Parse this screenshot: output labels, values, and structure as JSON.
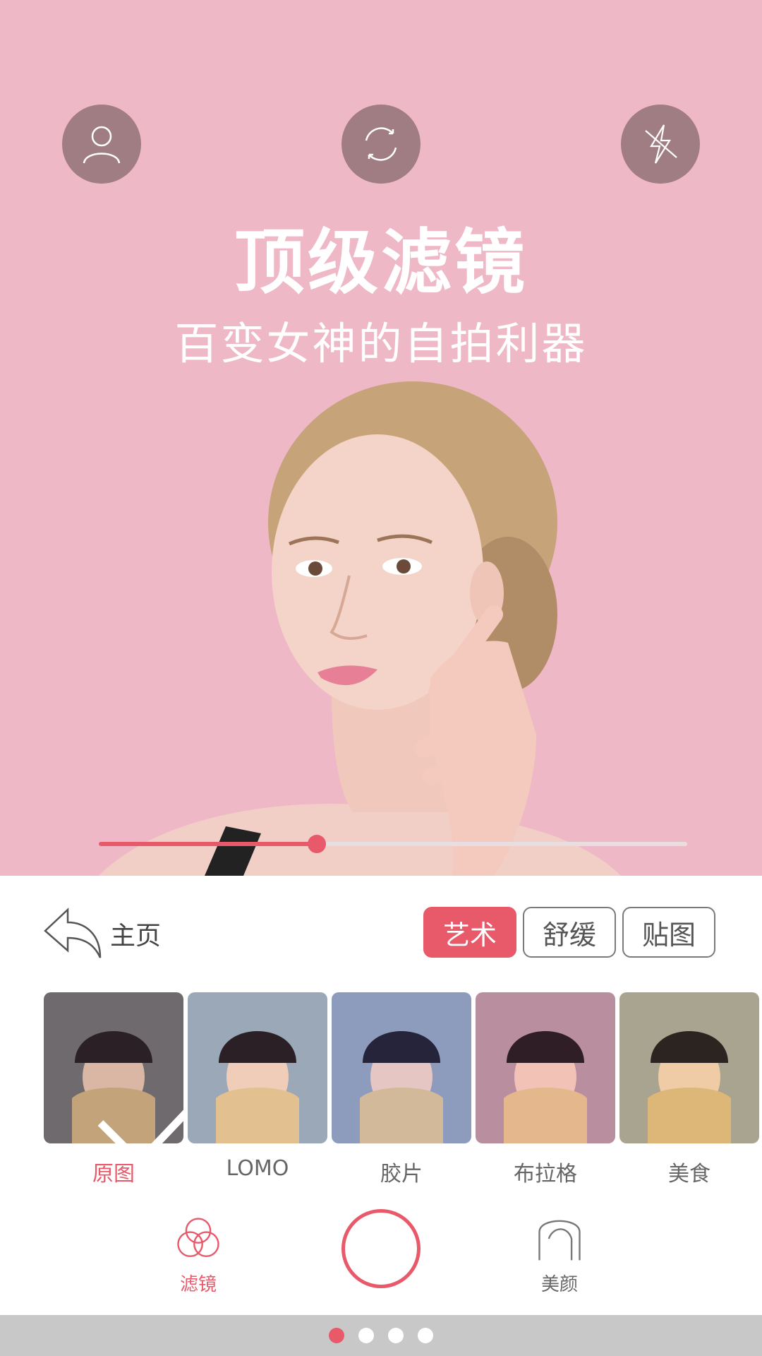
{
  "hero": {
    "title": "顶级滤镜",
    "subtitle": "百变女神的自拍利器"
  },
  "top_controls": [
    {
      "icon": "user-icon"
    },
    {
      "icon": "switch-camera-icon"
    },
    {
      "icon": "flash-off-icon"
    }
  ],
  "intensity_slider": {
    "value": 0.37
  },
  "toolbar": {
    "home_label": "主页",
    "tabs": [
      {
        "label": "艺术",
        "active": true
      },
      {
        "label": "舒缓",
        "active": false
      },
      {
        "label": "贴图",
        "active": false
      }
    ]
  },
  "filters": [
    {
      "label": "原图",
      "selected": true
    },
    {
      "label": "LOMO",
      "selected": false
    },
    {
      "label": "胶片",
      "selected": false
    },
    {
      "label": "布拉格",
      "selected": false
    },
    {
      "label": "美食",
      "selected": false
    }
  ],
  "bottom_nav": {
    "filter_label": "滤镜",
    "beauty_label": "美颜"
  },
  "pager": {
    "count": 4,
    "active": 0
  },
  "colors": {
    "accent": "#e8596a",
    "preview_bg": "#efb8c6",
    "control_bg": "#a07c83"
  }
}
